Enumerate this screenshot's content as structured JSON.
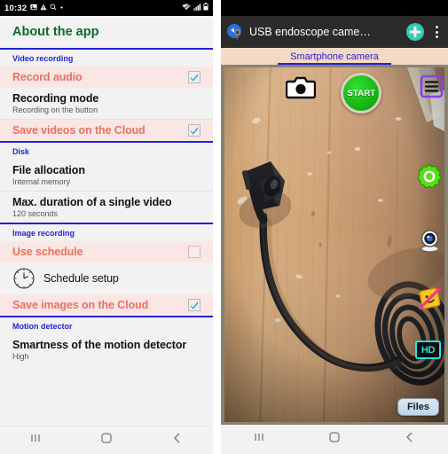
{
  "left_phone": {
    "status_bar": {
      "time": "10:32",
      "left_icons": [
        "image-icon",
        "warning-triangle-icon",
        "search-icon",
        "dot-icon"
      ],
      "right_icons": [
        "wifi-icon",
        "signal-icon",
        "battery-icon"
      ]
    },
    "header": {
      "title": "About the app"
    },
    "sections": [
      {
        "label": "Video recording",
        "rows": [
          {
            "title": "Record audio",
            "subtitle": "",
            "style": "pink",
            "control": "checkbox",
            "checked": true
          },
          {
            "title": "Recording mode",
            "subtitle": "Recording on the button",
            "style": "plain",
            "control": "none",
            "checked": false
          },
          {
            "title": "Save videos on the Cloud",
            "subtitle": "",
            "style": "pink",
            "control": "checkbox",
            "checked": true
          }
        ]
      },
      {
        "label": "Disk",
        "rows": [
          {
            "title": "File allocation",
            "subtitle": "Internal memory",
            "style": "plain",
            "control": "none",
            "checked": false
          },
          {
            "title": "Max. duration of a single video",
            "subtitle": "120 seconds",
            "style": "plain",
            "control": "none",
            "checked": false
          }
        ]
      },
      {
        "label": "Image recording",
        "rows": [
          {
            "title": "Use schedule",
            "subtitle": "",
            "style": "pink",
            "control": "checkbox",
            "checked": false
          },
          {
            "title": "Schedule setup",
            "subtitle": "",
            "style": "plain",
            "control": "clock-icon",
            "checked": false
          },
          {
            "title": "Save images on the Cloud",
            "subtitle": "",
            "style": "pink",
            "control": "checkbox",
            "checked": true
          }
        ]
      },
      {
        "label": "Motion detector",
        "rows": [
          {
            "title": "Smartness of the motion detector",
            "subtitle": "High",
            "style": "plain",
            "control": "none",
            "checked": false
          }
        ]
      }
    ],
    "nav_bar": {
      "recents": "recents-icon",
      "home": "home-icon",
      "back": "back-icon"
    }
  },
  "right_phone": {
    "app_bar": {
      "icon": "endoscope-app-icon",
      "title": "USB endoscope came…",
      "add_button": "plus-icon",
      "overflow": "more-options-icon"
    },
    "tab": {
      "label": "Smartphone camera"
    },
    "overlays": {
      "shutter": "camera-shutter-icon",
      "start_label": "START",
      "list": "list-icon",
      "settings": "gear-icon",
      "webcam": "webcam-icon",
      "face_off": "face-detection-off-icon",
      "hd_label": "HD",
      "files_label": "Files"
    },
    "nav_bar": {
      "recents": "recents-icon",
      "home": "home-icon",
      "back": "back-icon"
    }
  },
  "colors": {
    "header_green": "#0b6b28",
    "section_blue": "#2222d8",
    "pink_row_bg": "#fbe6e6",
    "pink_row_text": "#e8715c",
    "tab_bar_bg": "#f6d9c4",
    "start_green": "#18b918",
    "hd_cyan": "#22e6e6",
    "plus_teal": "#36c9b0"
  }
}
